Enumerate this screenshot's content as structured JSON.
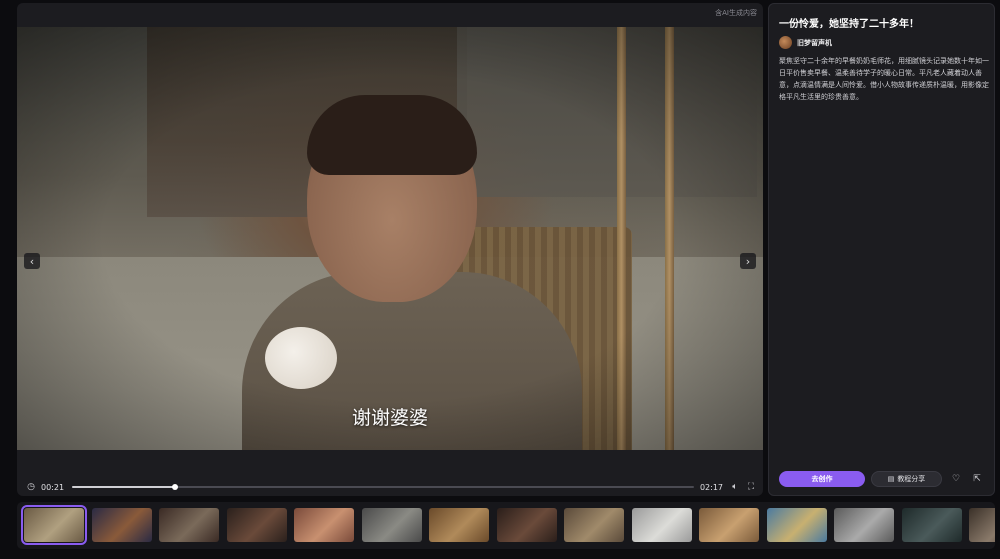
{
  "player": {
    "ai_label": "含AI生成内容",
    "subtitle": "谢谢婆婆",
    "current_time": "00:21",
    "duration": "02:17",
    "progress": 0.166,
    "prev_icon": "chevron-left-icon",
    "next_icon": "chevron-right-icon"
  },
  "details": {
    "title": "一份怜爱，她坚持了二十多年！",
    "author": "旧梦留声机",
    "description": "聚焦坚守二十余年的早餐奶奶毛师花，用细腻镜头记录她数十年如一日平价售卖早餐、温柔善待学子的暖心日常。平凡老人藏着动人善意，点滴温情满是人间怜爱。借小人物故事传递质朴温暖，用影像定格平凡生活里的珍贵善意。",
    "create_label": "去创作",
    "tutorial_label": "教程分享"
  },
  "thumbnails": [
    {
      "active": true,
      "colors": [
        "#6a5a44",
        "#b0a080"
      ]
    },
    {
      "active": false,
      "colors": [
        "#2a2a44",
        "#8a5a3a"
      ]
    },
    {
      "active": false,
      "colors": [
        "#3a2a24",
        "#7a6a5a"
      ]
    },
    {
      "active": false,
      "colors": [
        "#2a201c",
        "#6a4a3a"
      ]
    },
    {
      "active": false,
      "colors": [
        "#7a4a3a",
        "#c89070"
      ]
    },
    {
      "active": false,
      "colors": [
        "#4a4a4a",
        "#8a8a84"
      ]
    },
    {
      "active": false,
      "colors": [
        "#6a4a2a",
        "#b08a5a"
      ]
    },
    {
      "active": false,
      "colors": [
        "#2a1e1a",
        "#6a4a3a"
      ]
    },
    {
      "active": false,
      "colors": [
        "#5a4a3a",
        "#a08a6a"
      ]
    },
    {
      "active": false,
      "colors": [
        "#9a9a9a",
        "#dcdcd8"
      ]
    },
    {
      "active": false,
      "colors": [
        "#7a5a3a",
        "#c8a070"
      ]
    },
    {
      "active": false,
      "colors": [
        "#4a7aa0",
        "#c8b070"
      ]
    },
    {
      "active": false,
      "colors": [
        "#5a5a5a",
        "#aaaaaa"
      ]
    },
    {
      "active": false,
      "colors": [
        "#1e2a2a",
        "#4a5a5a"
      ]
    },
    {
      "active": false,
      "colors": [
        "#3a3028",
        "#8a7a6a"
      ]
    }
  ]
}
